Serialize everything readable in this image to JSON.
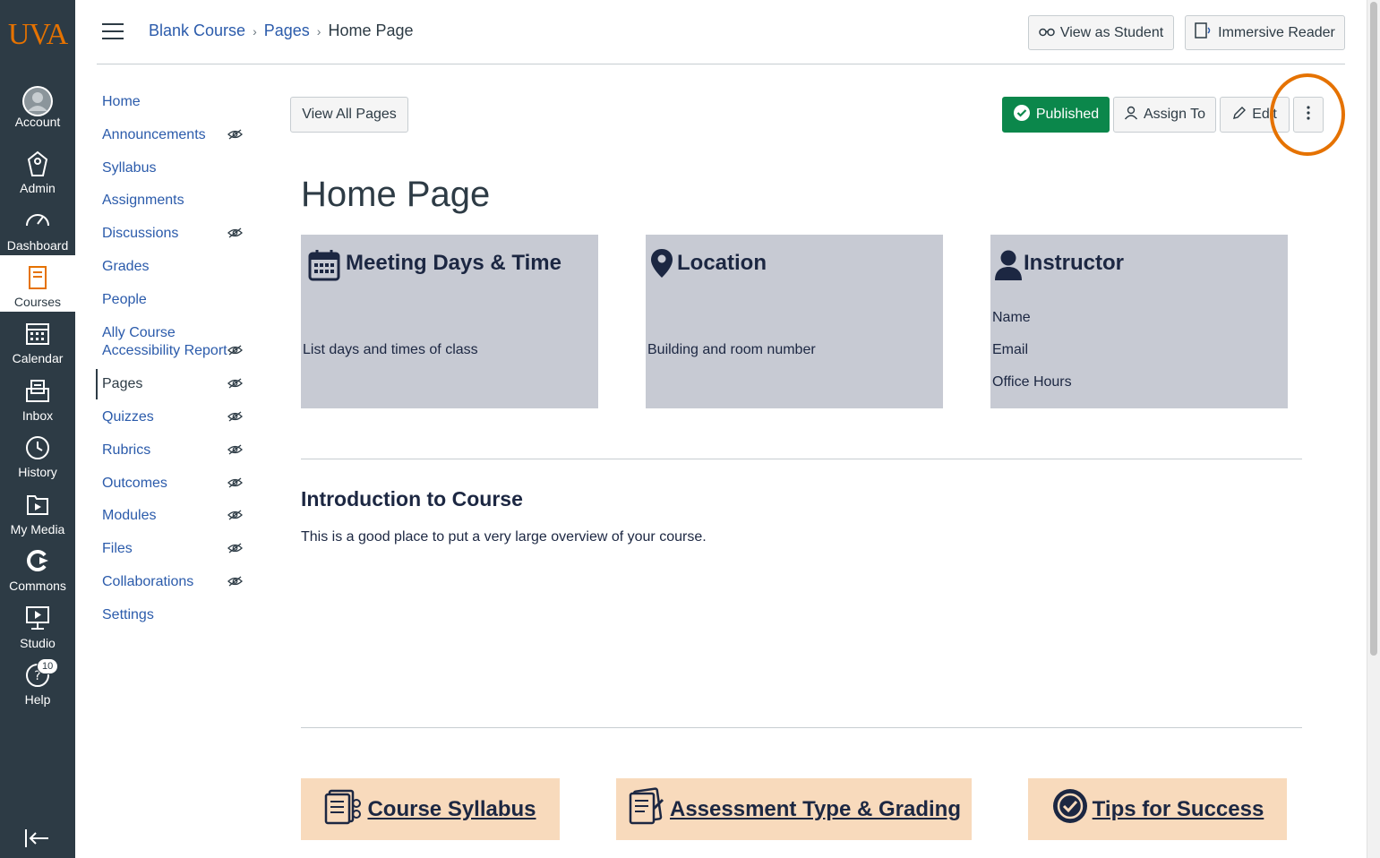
{
  "global_nav": {
    "logo": "UVA",
    "items": [
      {
        "label": "Account",
        "icon": "account-icon"
      },
      {
        "label": "Admin",
        "icon": "admin-icon"
      },
      {
        "label": "Dashboard",
        "icon": "dashboard-icon"
      },
      {
        "label": "Courses",
        "icon": "courses-icon"
      },
      {
        "label": "Calendar",
        "icon": "calendar-icon"
      },
      {
        "label": "Inbox",
        "icon": "inbox-icon"
      },
      {
        "label": "History",
        "icon": "history-icon"
      },
      {
        "label": "My Media",
        "icon": "my-media-icon"
      },
      {
        "label": "Commons",
        "icon": "commons-icon"
      },
      {
        "label": "Studio",
        "icon": "studio-icon"
      },
      {
        "label": "Help",
        "icon": "help-icon",
        "badge": "10"
      }
    ],
    "active": "Courses"
  },
  "breadcrumb": {
    "course": "Blank Course",
    "section": "Pages",
    "current": "Home Page"
  },
  "header_buttons": {
    "view_as_student": "View as Student",
    "immersive_reader": "Immersive Reader"
  },
  "course_nav": {
    "items": [
      {
        "label": "Home",
        "hidden": false
      },
      {
        "label": "Announcements",
        "hidden": true
      },
      {
        "label": "Syllabus",
        "hidden": false
      },
      {
        "label": "Assignments",
        "hidden": false
      },
      {
        "label": "Discussions",
        "hidden": true
      },
      {
        "label": "Grades",
        "hidden": false
      },
      {
        "label": "People",
        "hidden": false
      },
      {
        "label": "Ally Course Accessibility Report",
        "hidden": true
      },
      {
        "label": "Pages",
        "hidden": true
      },
      {
        "label": "Quizzes",
        "hidden": true
      },
      {
        "label": "Rubrics",
        "hidden": true
      },
      {
        "label": "Outcomes",
        "hidden": true
      },
      {
        "label": "Modules",
        "hidden": true
      },
      {
        "label": "Files",
        "hidden": true
      },
      {
        "label": "Collaborations",
        "hidden": true
      },
      {
        "label": "Settings",
        "hidden": false
      }
    ],
    "ally_line1": "Ally Course",
    "ally_line2": "Accessibility Report",
    "active": "Pages"
  },
  "toolbar": {
    "view_all_pages": "View All Pages",
    "published": "Published",
    "assign_to": "Assign To",
    "edit": "Edit"
  },
  "page": {
    "title": "Home Page",
    "cards": [
      {
        "heading": "Meeting Days & Time",
        "icon": "calendar-icon",
        "lines": [
          "List days and times of class"
        ]
      },
      {
        "heading": "Location",
        "icon": "map-pin-icon",
        "lines": [
          "Building and room number"
        ]
      },
      {
        "heading": "Instructor",
        "icon": "person-icon",
        "lines": [
          "Name",
          "Email",
          "Office Hours"
        ]
      }
    ],
    "intro_heading": "Introduction to Course",
    "intro_text": "This is a good place to put a very large overview of your course.",
    "links": [
      {
        "label": "Course Syllabus",
        "icon": "syllabus-doc-icon"
      },
      {
        "label": "Assessment Type & Grading",
        "icon": "assessment-doc-icon"
      },
      {
        "label": "Tips for Success ",
        "icon": "check-badge-icon"
      }
    ]
  },
  "colors": {
    "nav_bg": "#2d3b45",
    "link": "#2b5bab",
    "published": "#0b874b",
    "highlight": "#e57200",
    "card_bg": "#c7cad3",
    "link_bg": "#f8dabc"
  }
}
